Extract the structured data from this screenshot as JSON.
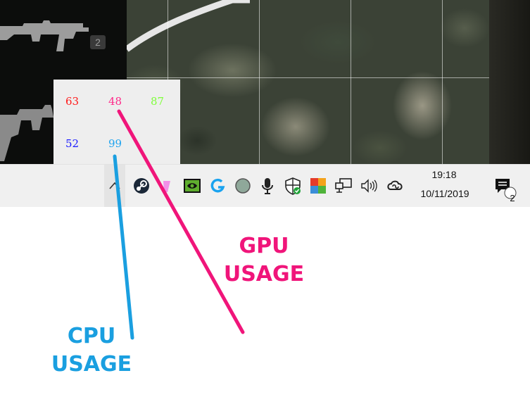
{
  "game": {
    "inventory_slot_number": "2"
  },
  "hw_monitor": {
    "readings": [
      {
        "value": "63",
        "color": "#ff1a1a"
      },
      {
        "value": "48",
        "color": "#ff2a8a"
      },
      {
        "value": "87",
        "color": "#7fff3a"
      },
      {
        "value": "52",
        "color": "#1a1aff"
      },
      {
        "value": "99",
        "color": "#1fa3ee"
      }
    ]
  },
  "taskbar": {
    "tray_icons": [
      "show-hidden-icons-chevron",
      "steam-icon",
      "pink-app-icon",
      "nvidia-icon",
      "logitech-g-icon",
      "circle-app-icon",
      "microphone-icon",
      "windows-security-icon",
      "color-grid-app-icon",
      "network-icon",
      "volume-icon",
      "creative-cloud-icon"
    ],
    "clock": {
      "time": "19:18",
      "date": "10/11/2019"
    },
    "notifications_count": "2"
  },
  "annotations": {
    "gpu": {
      "line1": "GPU",
      "line2": "USAGE",
      "color": "#f0157a"
    },
    "cpu": {
      "line1": "CPU",
      "line2": "USAGE",
      "color": "#1a9fe0"
    }
  }
}
